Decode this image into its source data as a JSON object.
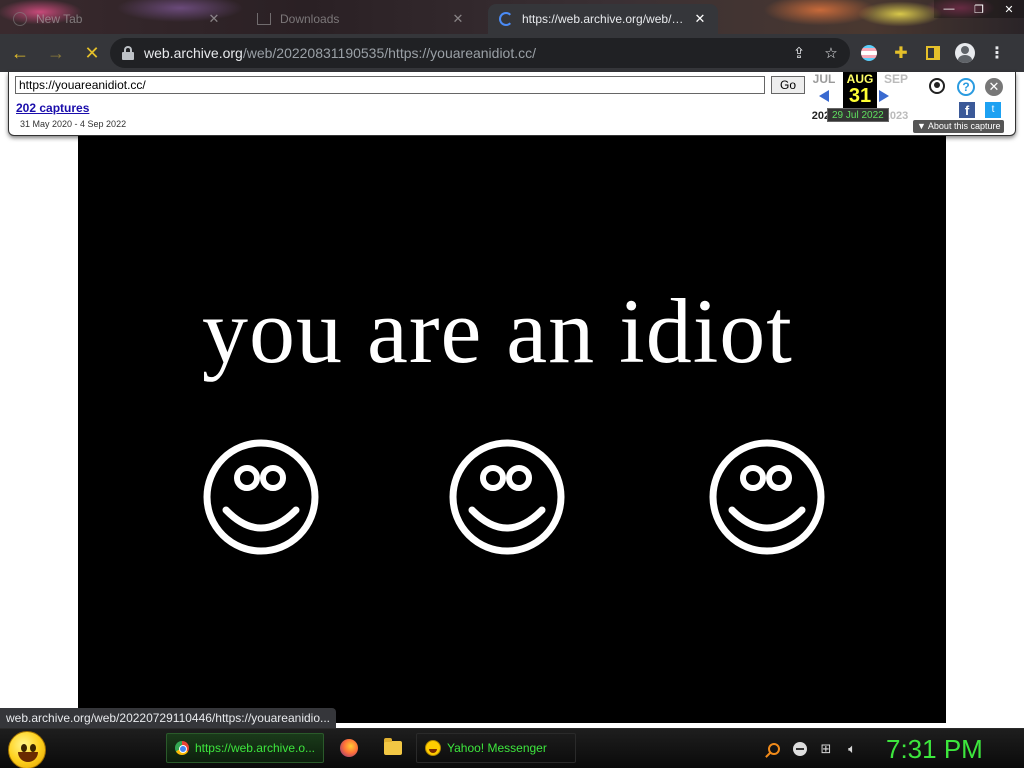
{
  "browser": {
    "tabs": [
      {
        "title": "New Tab",
        "state": "inactive",
        "icon": "globe-icon"
      },
      {
        "title": "Downloads",
        "state": "inactive",
        "icon": "download-icon"
      },
      {
        "title": "https://web.archive.org/web/202",
        "state": "loading",
        "icon": "loading-spinner-icon"
      }
    ],
    "window_controls": {
      "minimize": "—",
      "maximize": "❐",
      "close": "✕"
    },
    "toolbar": {
      "back": "←",
      "forward": "→",
      "stop": "✕",
      "url_host": "web.archive.org",
      "url_path": "/web/20220831190535/https://youareanidiot.cc/",
      "share_icon": "share-icon",
      "bookmark_icon": "star-icon",
      "menu": "⋮"
    }
  },
  "wayback": {
    "url_value": "https://youareanidiot.cc/",
    "go_label": "Go",
    "captures_link": "202 captures",
    "date_range": "31 May 2020 - 4 Sep 2022",
    "calendar": {
      "prev": {
        "month": "JUL",
        "year": "2021"
      },
      "current": {
        "month": "AUG",
        "day": "31",
        "year": "2022"
      },
      "next": {
        "month": "SEP",
        "year": "2023"
      }
    },
    "tooltip": "29 Jul 2022",
    "about_capture": "About this capture",
    "help_glyph": "?",
    "close_glyph": "✕",
    "facebook_glyph": "f",
    "twitter_glyph": "t"
  },
  "page": {
    "headline": "you are an idiot",
    "background": "#000000",
    "foreground": "#ffffff",
    "smiley_count": 3
  },
  "status_bar": {
    "text": "web.archive.org/web/20220729110446/https://youareanidio..."
  },
  "taskbar": {
    "items": [
      {
        "label": "https://web.archive.o...",
        "icon": "chrome-icon",
        "active": true
      },
      {
        "label": "",
        "icon": "firefox-icon",
        "active": false
      },
      {
        "label": "",
        "icon": "folder-icon",
        "active": false
      },
      {
        "label": "Yahoo! Messenger",
        "icon": "yahoo-messenger-icon",
        "active": false
      }
    ],
    "clock": "7:31 PM",
    "accent": "#3de63d"
  }
}
